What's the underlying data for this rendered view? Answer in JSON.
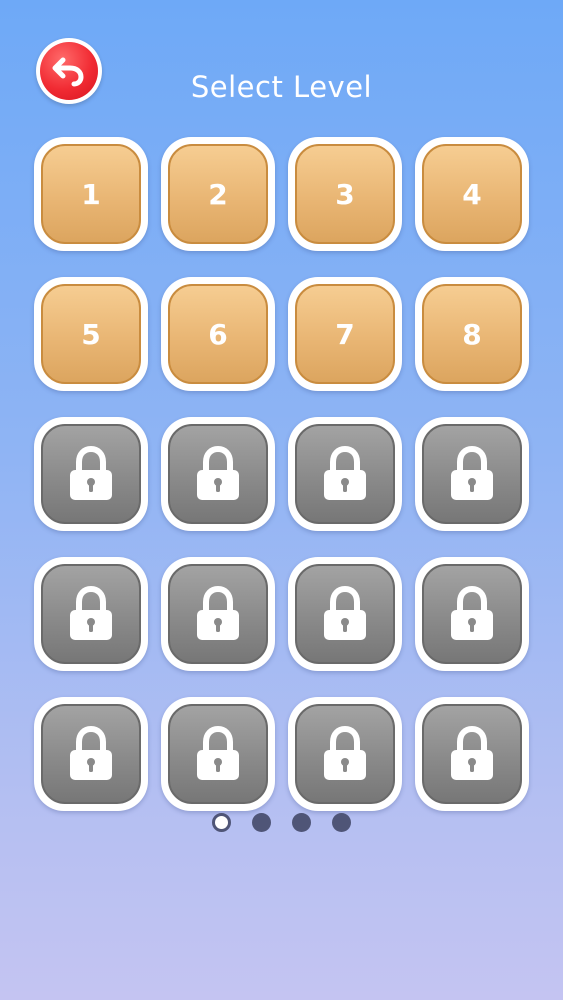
{
  "header": {
    "back_icon": "undo-arrow-icon",
    "title": "Select Level"
  },
  "colors": {
    "unlocked_tile": "#e9b674",
    "locked_tile": "#8a8a8a",
    "back_button": "#f12b33"
  },
  "levels": [
    {
      "label": "1",
      "locked": false
    },
    {
      "label": "2",
      "locked": false
    },
    {
      "label": "3",
      "locked": false
    },
    {
      "label": "4",
      "locked": false
    },
    {
      "label": "5",
      "locked": false
    },
    {
      "label": "6",
      "locked": false
    },
    {
      "label": "7",
      "locked": false
    },
    {
      "label": "8",
      "locked": false
    },
    {
      "label": "",
      "locked": true,
      "icon": "lock-icon"
    },
    {
      "label": "",
      "locked": true,
      "icon": "lock-icon"
    },
    {
      "label": "",
      "locked": true,
      "icon": "lock-icon"
    },
    {
      "label": "",
      "locked": true,
      "icon": "lock-icon"
    },
    {
      "label": "",
      "locked": true,
      "icon": "lock-icon"
    },
    {
      "label": "",
      "locked": true,
      "icon": "lock-icon"
    },
    {
      "label": "",
      "locked": true,
      "icon": "lock-icon"
    },
    {
      "label": "",
      "locked": true,
      "icon": "lock-icon"
    },
    {
      "label": "",
      "locked": true,
      "icon": "lock-icon"
    },
    {
      "label": "",
      "locked": true,
      "icon": "lock-icon"
    },
    {
      "label": "",
      "locked": true,
      "icon": "lock-icon"
    },
    {
      "label": "",
      "locked": true,
      "icon": "lock-icon"
    }
  ],
  "pagination": {
    "page_count": 4,
    "current_page": 1
  }
}
